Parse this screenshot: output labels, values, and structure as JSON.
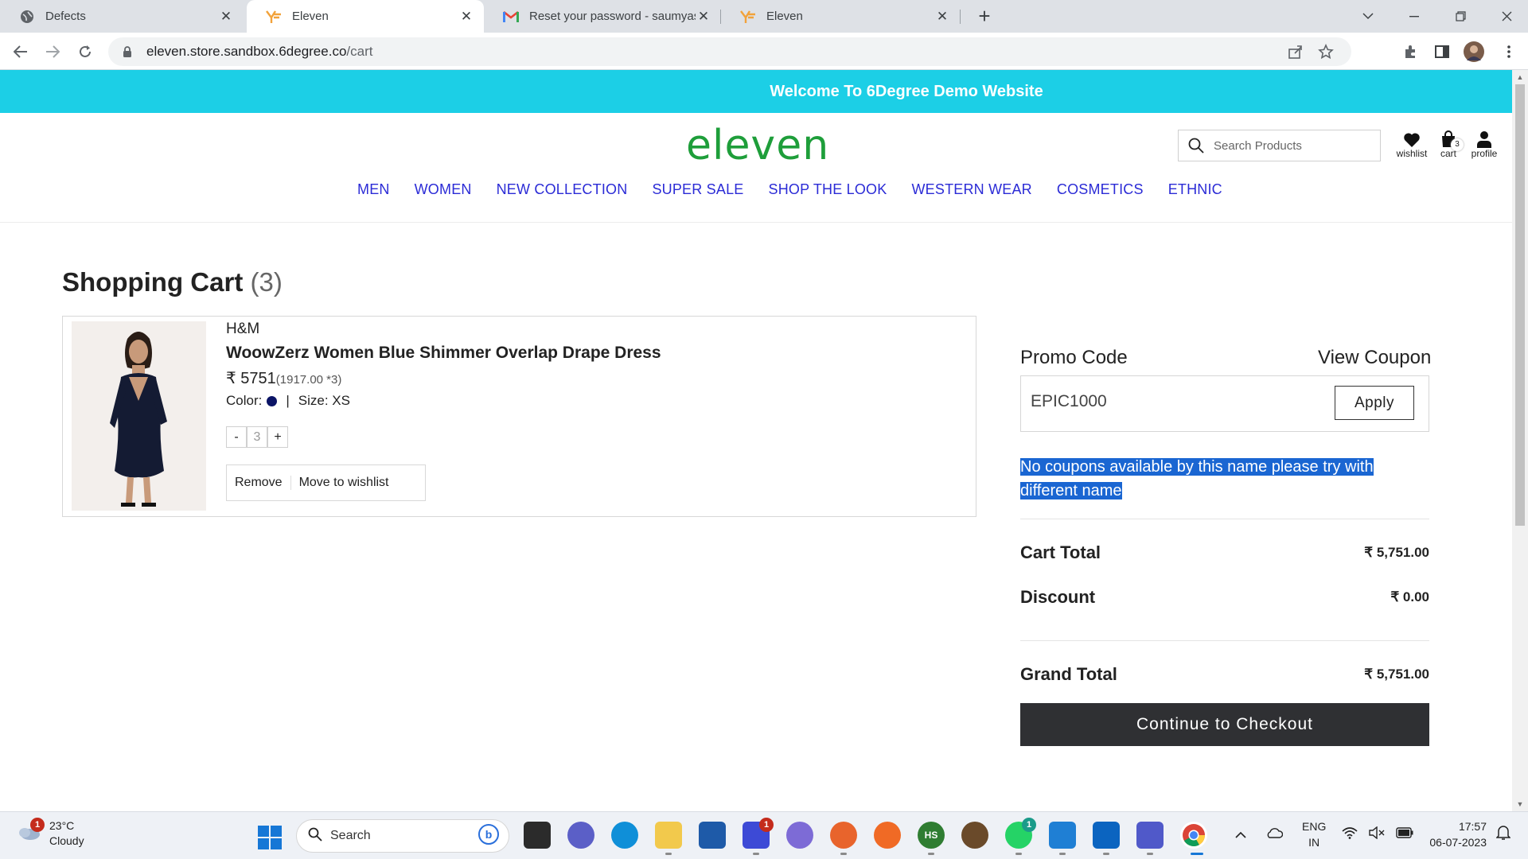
{
  "browser": {
    "tabs": [
      {
        "title": "Defects",
        "icon": "globe-icon"
      },
      {
        "title": "Eleven",
        "icon": "eleven-favicon",
        "active": true
      },
      {
        "title": "Reset your password - saumyash",
        "icon": "gmail-icon"
      },
      {
        "title": "Eleven",
        "icon": "eleven-favicon"
      }
    ],
    "url_host": "eleven.store.sandbox.6degree.co",
    "url_path": "/cart"
  },
  "site": {
    "banner": "Welcome To 6Degree Demo Website",
    "logo": "eleven",
    "search_placeholder": "Search Products",
    "header_icons": {
      "wishlist": "wishlist",
      "cart": "cart",
      "cart_count": "3",
      "profile": "profile"
    },
    "menu": [
      "MEN",
      "WOMEN",
      "NEW COLLECTION",
      "SUPER SALE",
      "SHOP THE LOOK",
      "WESTERN WEAR",
      "COSMETICS",
      "ETHNIC"
    ],
    "link_color": "#2b2bd6",
    "banner_color": "#1ccfe6",
    "logo_color": "#1e9e3a"
  },
  "cart": {
    "title": "Shopping Cart",
    "count": "(3)",
    "item": {
      "brand": "H&M",
      "name": "WoowZerz Women Blue Shimmer Overlap Drape Dress",
      "price": "₹ 5751",
      "price_detail": "(1917.00 *3)",
      "color_label": "Color:",
      "color_swatch": "#0b1466",
      "separator": "|",
      "size": "Size: XS",
      "qty_minus": "-",
      "qty": "3",
      "qty_plus": "+",
      "remove": "Remove",
      "move_to_wishlist": "Move to wishlist"
    }
  },
  "summary": {
    "promo_label": "Promo Code",
    "view_coupon": "View Coupon",
    "promo_value": "EPIC1000",
    "apply": "Apply",
    "error_line1": "No coupons available by this name please try with",
    "error_line2": "different name",
    "cart_total_label": "Cart Total",
    "cart_total": "₹ 5,751.00",
    "discount_label": "Discount",
    "discount": "₹ 0.00",
    "grand_total_label": "Grand Total",
    "grand_total": "₹ 5,751.00",
    "checkout": "Continue to Checkout"
  },
  "taskbar": {
    "weather_temp": "23°C",
    "weather_desc": "Cloudy",
    "weather_badge": "1",
    "search": "Search",
    "lang1": "ENG",
    "lang2": "IN",
    "time": "17:57",
    "date": "06-07-2023",
    "app_badge_1": "1",
    "app_badge_2": "1"
  }
}
